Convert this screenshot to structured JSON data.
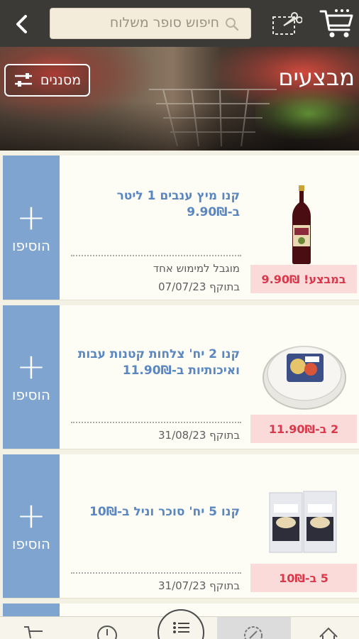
{
  "header": {
    "search_placeholder": "חיפוש סופר משלוח",
    "icons": [
      "chevron-left-icon",
      "search-icon",
      "coupon-scissors-icon",
      "shopping-cart-icon"
    ]
  },
  "hero": {
    "title": "מבצעים",
    "filter_label": "מסננים"
  },
  "offers": [
    {
      "title": "קנו מיץ ענבים 1 ליטר ב-9.90₪",
      "limit_note": "מוגבל למימוש אחד",
      "validity": "בתוקף 07/07/23",
      "price_tag": "במבצע! 9.90₪",
      "add_label": "הוסיפו",
      "add_symbol": "+",
      "image": "grape-juice-bottle"
    },
    {
      "title": "קנו 2 יח' צלחות קטנות עבות ואיכותיות ב-11.90₪",
      "validity": "בתוקף 31/08/23",
      "price_tag": "2 ב-11.90₪",
      "add_label": "הוסיפו",
      "add_symbol": "+",
      "image": "paper-plates"
    },
    {
      "title": "קנו 5 יח' סוכר וניל ב-10₪",
      "validity": "בתוקף 31/07/23",
      "price_tag": "5 ב-10₪",
      "add_label": "הוסיפו",
      "add_symbol": "+",
      "image": "vanilla-sugar-packs"
    }
  ],
  "bottom_nav": {
    "icons": [
      "cart-nav-icon",
      "history-clock-icon",
      "list-icon",
      "percent-deals-icon",
      "home-icon"
    ],
    "active": "percent-deals-icon"
  },
  "colors": {
    "topbar": "#3b3a37",
    "add_button": "#7ea4cf",
    "offer_title": "#5b87c0",
    "price_tag_bg": "#fbdada",
    "price_tag_text": "#d9394a",
    "page_bg": "#f3f1e3"
  }
}
